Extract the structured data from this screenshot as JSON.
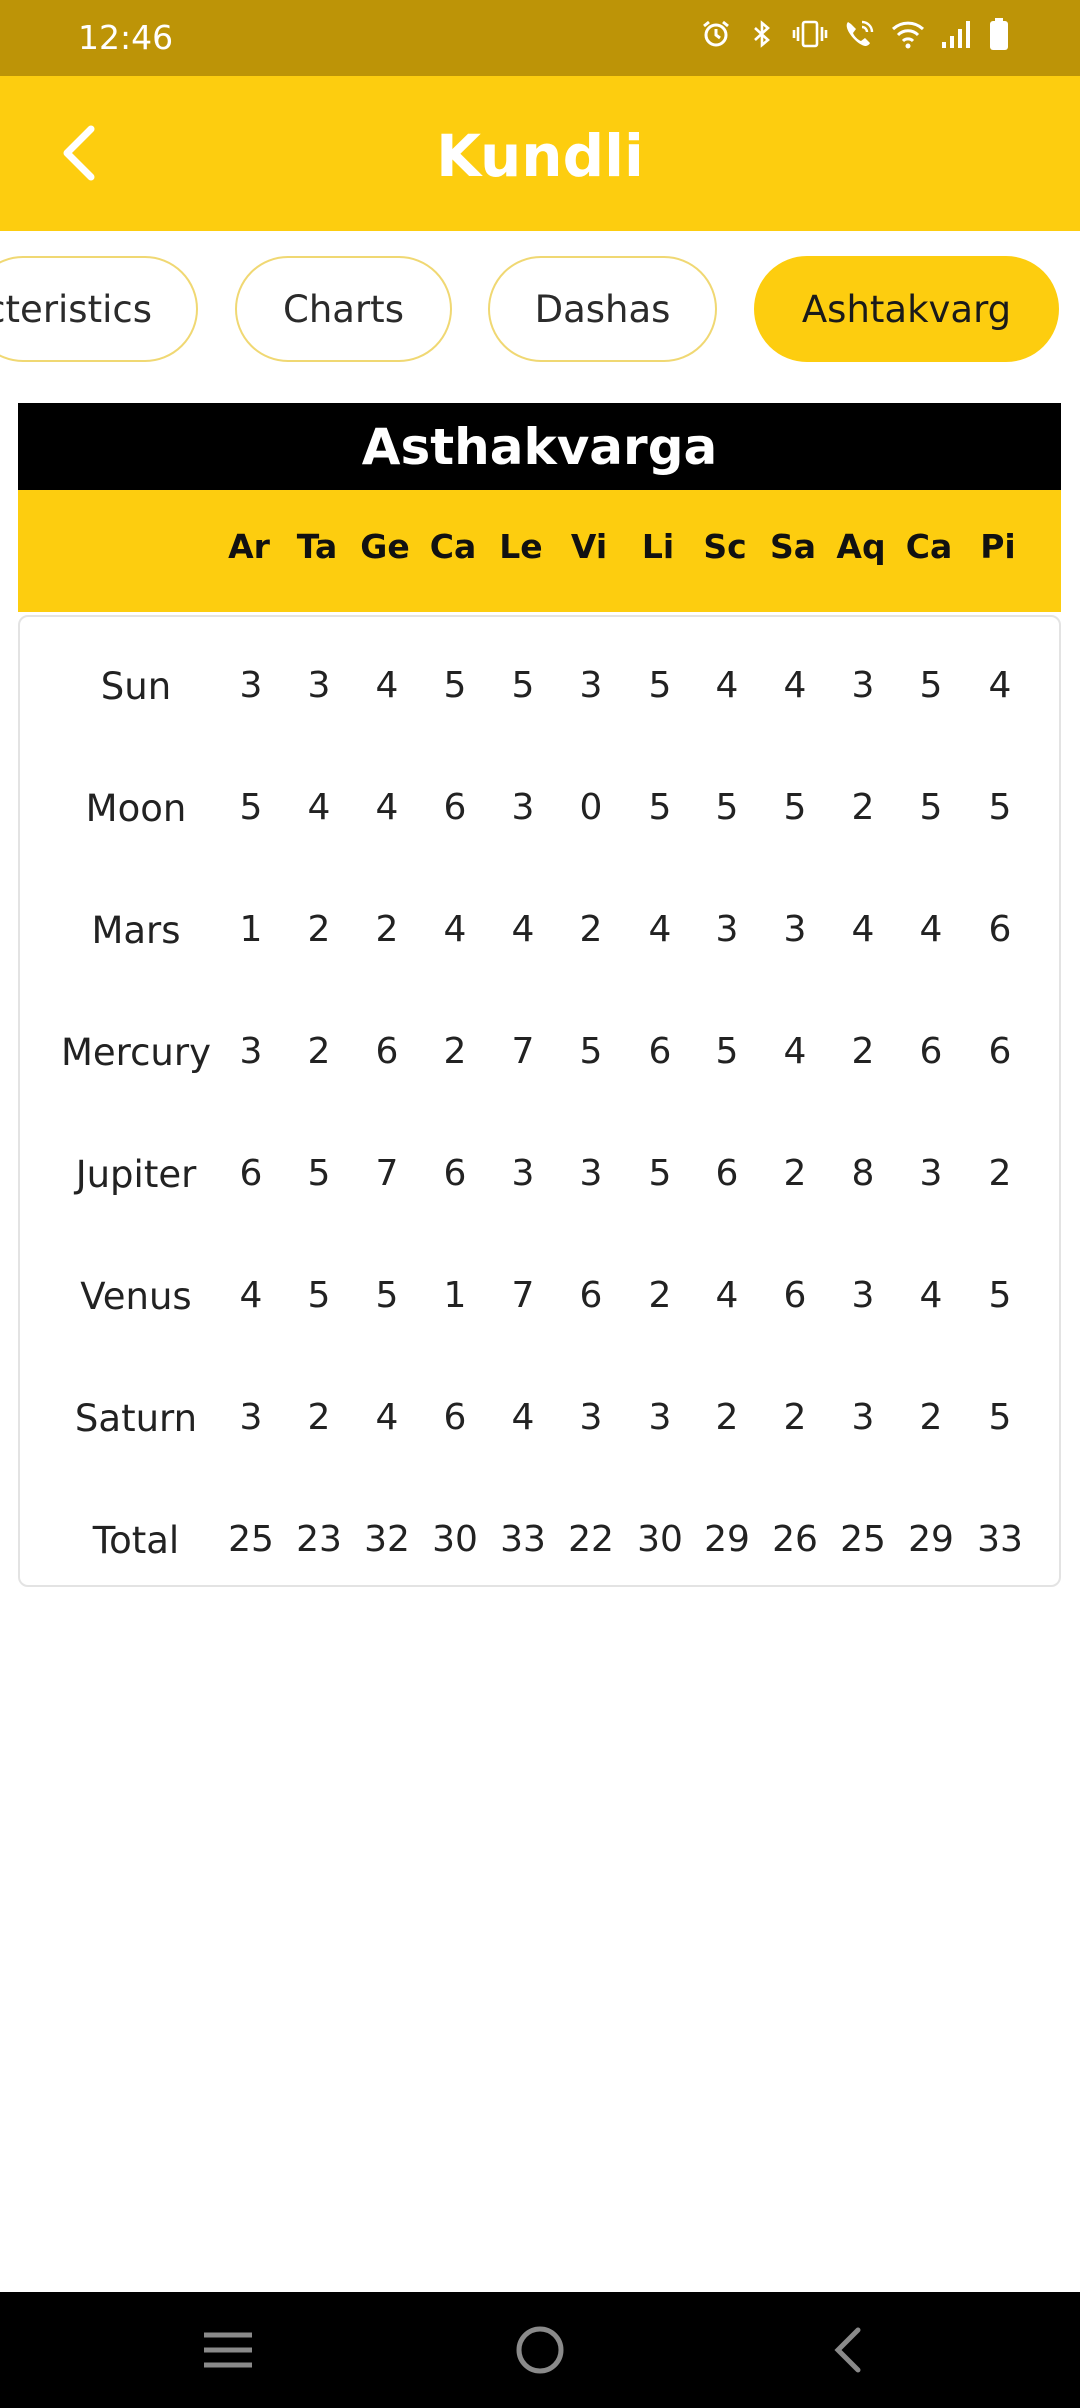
{
  "status_bar": {
    "time": "12:46",
    "icons": [
      "alarm-icon",
      "bluetooth-icon",
      "vibrate-icon",
      "wifi-calling-icon",
      "wifi-icon",
      "signal-icon",
      "battery-icon"
    ]
  },
  "app_bar": {
    "title": "Kundli",
    "back_icon": "chevron-left-icon"
  },
  "tabs": [
    {
      "label": "Characteristics",
      "active": false
    },
    {
      "label": "Charts",
      "active": false
    },
    {
      "label": "Dashas",
      "active": false
    },
    {
      "label": "Ashtakvarg",
      "active": true
    }
  ],
  "table": {
    "title": "Asthakvarga",
    "columns": [
      "Ar",
      "Ta",
      "Ge",
      "Ca",
      "Le",
      "Vi",
      "Li",
      "Sc",
      "Sa",
      "Aq",
      "Ca",
      "Pi"
    ],
    "rows": [
      {
        "label": "Sun",
        "values": [
          "3",
          "3",
          "4",
          "5",
          "5",
          "3",
          "5",
          "4",
          "4",
          "3",
          "5",
          "4"
        ]
      },
      {
        "label": "Moon",
        "values": [
          "5",
          "4",
          "4",
          "6",
          "3",
          "0",
          "5",
          "5",
          "5",
          "2",
          "5",
          "5"
        ]
      },
      {
        "label": "Mars",
        "values": [
          "1",
          "2",
          "2",
          "4",
          "4",
          "2",
          "4",
          "3",
          "3",
          "4",
          "4",
          "6"
        ]
      },
      {
        "label": "Mercury",
        "values": [
          "3",
          "2",
          "6",
          "2",
          "7",
          "5",
          "6",
          "5",
          "4",
          "2",
          "6",
          "6"
        ]
      },
      {
        "label": "Jupiter",
        "values": [
          "6",
          "5",
          "7",
          "6",
          "3",
          "3",
          "5",
          "6",
          "2",
          "8",
          "3",
          "2"
        ]
      },
      {
        "label": "Venus",
        "values": [
          "4",
          "5",
          "5",
          "1",
          "7",
          "6",
          "2",
          "4",
          "6",
          "3",
          "4",
          "5"
        ]
      },
      {
        "label": "Saturn",
        "values": [
          "3",
          "2",
          "4",
          "6",
          "4",
          "3",
          "3",
          "2",
          "2",
          "3",
          "2",
          "5"
        ]
      },
      {
        "label": "Total",
        "values": [
          "25",
          "23",
          "32",
          "30",
          "33",
          "22",
          "30",
          "29",
          "26",
          "25",
          "29",
          "33"
        ]
      }
    ]
  },
  "nav_bar": {
    "icons": [
      "menu-icon",
      "home-icon",
      "back-icon"
    ]
  },
  "colors": {
    "status_bar": "#bd9407",
    "accent": "#fdcd0f",
    "title_bar": "#000000",
    "nav_bar": "#000000"
  }
}
